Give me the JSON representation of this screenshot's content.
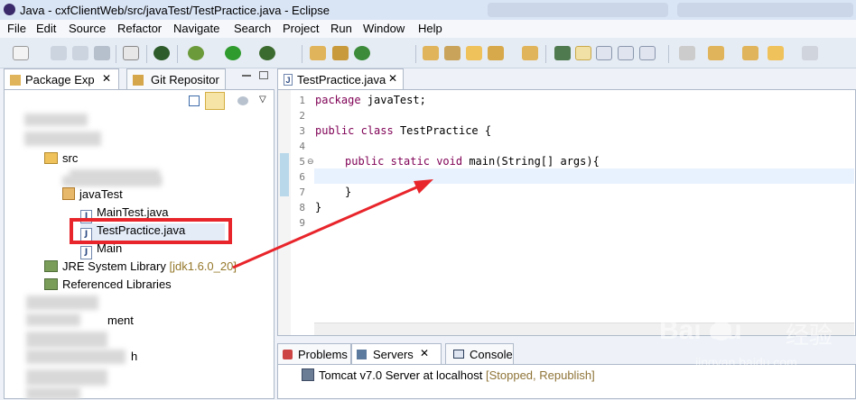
{
  "window": {
    "title": "Java - cxfClientWeb/src/javaTest/TestPractice.java - Eclipse"
  },
  "menu": [
    "File",
    "Edit",
    "Source",
    "Refactor",
    "Navigate",
    "Search",
    "Project",
    "Run",
    "Window",
    "Help"
  ],
  "left_tabs": {
    "package_explorer": "Package Exp",
    "git": "Git Repositor"
  },
  "tree": {
    "src": "src",
    "javaTest": "javaTest",
    "main_test": "MainTest.java",
    "test_practice": "TestPractice.java",
    "main": "Main",
    "jre": "JRE System Library",
    "jre_version": "[jdk1.6.0_20]",
    "ref_libs": "Referenced Libraries",
    "frag_ment": "ment",
    "frag_h": "h"
  },
  "editor": {
    "tab": "TestPractice.java",
    "line_numbers": [
      "1",
      "2",
      "3",
      "4",
      "5",
      "6",
      "7",
      "8",
      "9"
    ],
    "lines": {
      "l1_kw": "package",
      "l1_rest": " javaTest;",
      "l3_kw1": "public",
      "l3_kw2": "class",
      "l3_rest": " TestPractice {",
      "l5_kw1": "public",
      "l5_kw2": "static",
      "l5_kw3": "void",
      "l5_rest": " main(String[] args){",
      "l7": "}",
      "l8": "}"
    }
  },
  "bottom": {
    "tabs": [
      "Problems",
      "Servers",
      "Console"
    ],
    "server_name": "Tomcat v7.0 Server at localhost",
    "server_status": "[Stopped, Republish]"
  },
  "watermark": {
    "brand": "Bai  du",
    "cn": "经验",
    "url": "jingyan.baidu.com"
  },
  "colors": {
    "annotation_red": "#e8252b",
    "keyword": "#7f0055",
    "selection_blue": "#cfe0f5"
  }
}
